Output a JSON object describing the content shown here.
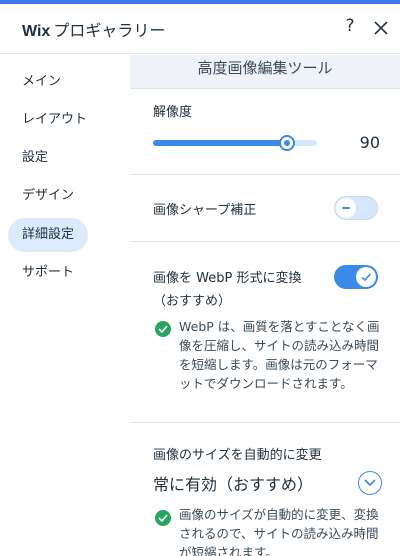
{
  "header": {
    "brand": "Wix",
    "title": "プロギャラリー",
    "help_label": "?"
  },
  "sidebar": {
    "items": [
      {
        "label": "メイン"
      },
      {
        "label": "レイアウト"
      },
      {
        "label": "設定"
      },
      {
        "label": "デザイン"
      },
      {
        "label": "詳細設定",
        "active": true
      },
      {
        "label": "サポート"
      }
    ]
  },
  "panel": {
    "title": "高度画像編集ツール",
    "resolution": {
      "label": "解像度",
      "value": "90",
      "level": 0.82
    },
    "sharpen": {
      "label": "画像シャープ補正",
      "enabled": false
    },
    "webp": {
      "label_line1": "画像を WebP 形式に変換",
      "label_line2": "（おすすめ）",
      "enabled": true,
      "note": "WebP は、画質を落とすことなく画像を圧縮し、サイトの読み込み時間を短縮します。画像は元のフォーマットでダウンロードされます。"
    },
    "auto_resize": {
      "label": "画像のサイズを自動的に変更",
      "value": "常に有効（おすすめ）",
      "note": "画像のサイズが自動的に変更、変換されるので、サイトの読み込み時間が短縮されます。"
    }
  },
  "colors": {
    "accent": "#3b89e9",
    "active_nav": "#dbeafc",
    "success": "#25a55f"
  }
}
